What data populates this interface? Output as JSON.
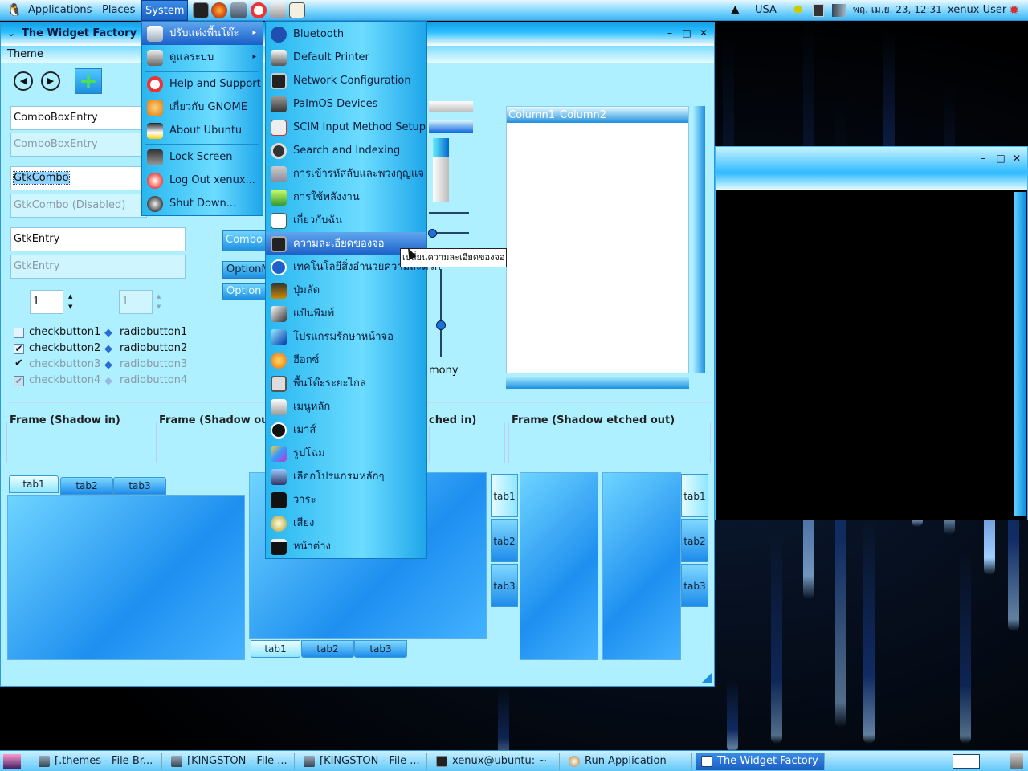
{
  "top_panel": {
    "menus": [
      "Applications",
      "Places",
      "System"
    ],
    "keyboard_layout": "USA",
    "clock": "พฤ. เม.ย. 23, 12:31",
    "user": "xenux User"
  },
  "widget_window": {
    "title": "The Widget Factory",
    "menubar_item": "Theme",
    "combo_entry": "ComboBoxEntry",
    "combo_entry_disabled": "ComboBoxEntry",
    "gtkcombo": "GtkCombo",
    "gtkcombo_disabled": "GtkCombo (Disabled)",
    "entry": "GtkEntry",
    "entry_disabled": "GtkEntry",
    "spin1": "1",
    "spin2": "1",
    "hidden_button_partial": "Combo",
    "option_partial_1": "OptionM",
    "option_partial_2": "Option",
    "checks": [
      "checkbutton1",
      "checkbutton2",
      "checkbutton3",
      "checkbutton4"
    ],
    "radios": [
      "radiobutton1",
      "radiobutton2",
      "radiobutton3",
      "radiobutton4"
    ],
    "scale_label_partial": "mony",
    "list_columns": [
      "Column1",
      "Column2"
    ],
    "frames": [
      "Frame (Shadow in)",
      "Frame (Shadow ou",
      "ched in)",
      "Frame (Shadow etched out)"
    ],
    "tabs": [
      "tab1",
      "tab2",
      "tab3"
    ]
  },
  "system_menu": {
    "items": [
      {
        "label": "ปรับแต่งพื้นโต๊ะ",
        "icon": "preferences-icon",
        "submenu": true
      },
      {
        "label": "ดูแลระบบ",
        "icon": "administration-icon",
        "submenu": true
      },
      {
        "label": "Help and Support",
        "icon": "help-lifebuoy-icon"
      },
      {
        "label": "เกี่ยวกับ GNOME",
        "icon": "gnome-foot-icon"
      },
      {
        "label": "About Ubuntu",
        "icon": "ubuntu-penguin-icon"
      },
      {
        "label": "Lock Screen",
        "icon": "lock-screen-icon"
      },
      {
        "label": "Log Out xenux...",
        "icon": "log-out-icon"
      },
      {
        "label": "Shut Down...",
        "icon": "shut-down-icon"
      }
    ]
  },
  "preferences_submenu": {
    "items": [
      {
        "label": "Bluetooth",
        "icon": "bluetooth-icon"
      },
      {
        "label": "Default Printer",
        "icon": "printer-icon"
      },
      {
        "label": "Network Configuration",
        "icon": "network-icon"
      },
      {
        "label": "PalmOS Devices",
        "icon": "palm-device-icon"
      },
      {
        "label": "SCIM Input Method Setup",
        "icon": "scim-icon"
      },
      {
        "label": "Search and Indexing",
        "icon": "search-icon"
      },
      {
        "label": "การเข้ารหัสลับและพวงกุญแจ",
        "icon": "keyring-icon"
      },
      {
        "label": "การใช้พลังงาน",
        "icon": "power-icon"
      },
      {
        "label": "เกี่ยวกับฉัน",
        "icon": "about-me-icon"
      },
      {
        "label": "ความละเอียดของจอ",
        "icon": "monitor-icon"
      },
      {
        "label": "เทคโนโลยีสิ่งอำนวยความสะดวก",
        "icon": "accessibility-icon"
      },
      {
        "label": "ปุ่มลัด",
        "icon": "shortcuts-icon"
      },
      {
        "label": "แป้นพิมพ์",
        "icon": "keyboard-icon"
      },
      {
        "label": "โปรแกรมรักษาหน้าจอ",
        "icon": "screensaver-icon"
      },
      {
        "label": "ฮีอกซ์",
        "icon": "theme-icon"
      },
      {
        "label": "พื้นโต๊ะระยะไกล",
        "icon": "remote-desktop-icon"
      },
      {
        "label": "เมนูหลัก",
        "icon": "main-menu-icon"
      },
      {
        "label": "เมาส์",
        "icon": "mouse-icon"
      },
      {
        "label": "รูปโฉม",
        "icon": "appearance-icon"
      },
      {
        "label": "เลือกโปรแกรมหลักๆ",
        "icon": "preferred-apps-icon"
      },
      {
        "label": "วาระ",
        "icon": "sessions-icon"
      },
      {
        "label": "เสียง",
        "icon": "sound-icon"
      },
      {
        "label": "หน้าต่าง",
        "icon": "windows-icon"
      }
    ],
    "highlighted_index": 9
  },
  "tooltip": "เปลี่ยนความละเอียดของจอ",
  "taskbar": {
    "tasks": [
      "[.themes - File Br...",
      "[KINGSTON - File ...",
      "[KINGSTON - File ...",
      "xenux@ubuntu: ~",
      "Run Application",
      "The Widget Factory"
    ],
    "active_index": 5
  },
  "colors": {
    "accent": "#1b5ec4",
    "menu_bg": "#4fcaf8",
    "panel": "#7fd6ff"
  }
}
